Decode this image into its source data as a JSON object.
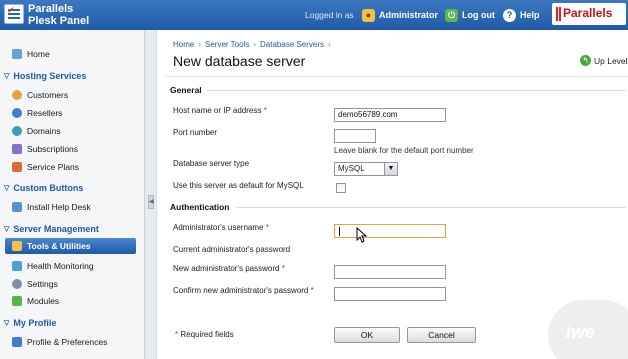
{
  "header": {
    "brand_line1": "Parallels",
    "brand_line2": "Plesk Panel",
    "logged_in_as": "Logged in as",
    "user": "Administrator",
    "logout": "Log out",
    "help": "Help",
    "vendor_logo": "Parallels"
  },
  "sidebar": {
    "home": "Home",
    "sections": [
      {
        "title": "Hosting Services",
        "items": [
          "Customers",
          "Resellers",
          "Domains",
          "Subscriptions",
          "Service Plans"
        ]
      },
      {
        "title": "Custom Buttons",
        "items": [
          "Install Help Desk"
        ]
      },
      {
        "title": "Server Management",
        "items": [
          "Tools & Utilities",
          "Health Monitoring",
          "Settings",
          "Modules"
        ]
      },
      {
        "title": "My Profile",
        "items": [
          "Profile & Preferences"
        ]
      }
    ],
    "active_item": "Tools & Utilities"
  },
  "breadcrumb": [
    "Home",
    "Server Tools",
    "Database Servers"
  ],
  "page_title": "New database server",
  "up_level": "Up Level",
  "form": {
    "general_title": "General",
    "host_label": "Host name or IP address",
    "host_value": "demo56789.com",
    "port_label": "Port number",
    "port_value": "",
    "port_hint": "Leave blank for the default port number",
    "type_label": "Database server type",
    "type_value": "MySQL",
    "default_label": "Use this server as default for MySQL",
    "default_checked": false,
    "auth_title": "Authentication",
    "admin_user_label": "Administrator's username",
    "admin_user_value": "",
    "current_pass_label": "Current administrator's password",
    "new_pass_label": "New administrator's password",
    "confirm_pass_label": "Confirm new administrator's password",
    "required_star": "*",
    "required_note": "Required fields",
    "ok": "OK",
    "cancel": "Cancel"
  },
  "watermark": "iwe",
  "colors": {
    "header": "#1f5aa6",
    "link": "#1f5aa6",
    "required": "#dd2222",
    "focus_border": "#e6a33c"
  }
}
